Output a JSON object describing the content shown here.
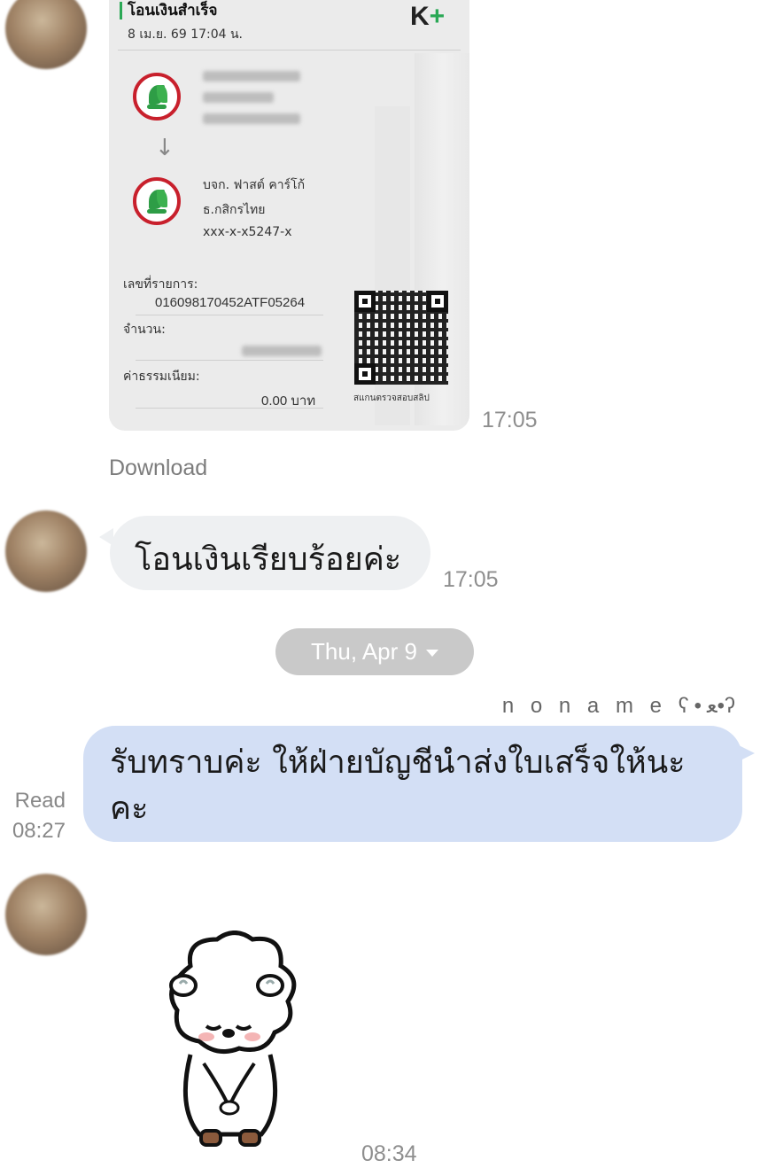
{
  "messages": {
    "slip": {
      "title": "โอนเงินสำเร็จ",
      "date": "8 เม.ย. 69 17:04 น.",
      "brand": "K+",
      "recipient_name": "บจก. ฟาสต์ คาร์โก้",
      "recipient_bank": "ธ.กสิกรไทย",
      "recipient_account": "xxx-x-x5247-x",
      "ref_label": "เลขที่รายการ:",
      "ref_value": "016098170452ATF05264",
      "amount_label": "จำนวน:",
      "fee_label": "ค่าธรรมเนียม:",
      "fee_value": "0.00 บาท",
      "qr_caption": "สแกนตรวจสอบสลิป",
      "time": "17:05",
      "download_label": "Download"
    },
    "incoming_text": {
      "text": "โอนเงินเรียบร้อยค่ะ",
      "time": "17:05"
    },
    "date_separator": "Thu, Apr 9",
    "outgoing": {
      "sender": "n o n a m e ʕ•ﻌ•ʔ",
      "text": "รับทราบค่ะ ให้ฝ่ายบัญชีนำส่งใบเสร็จให้นะคะ",
      "read_label": "Read",
      "time": "08:27"
    },
    "sticker": {
      "time": "08:34",
      "icon": "sheep-bow-sticker"
    }
  },
  "colors": {
    "incoming_bubble": "#eef0f2",
    "outgoing_bubble": "#d3dff5",
    "date_pill": "#c9c9c9",
    "kbank_red": "#c8202c",
    "kbank_green": "#2e9d46"
  }
}
